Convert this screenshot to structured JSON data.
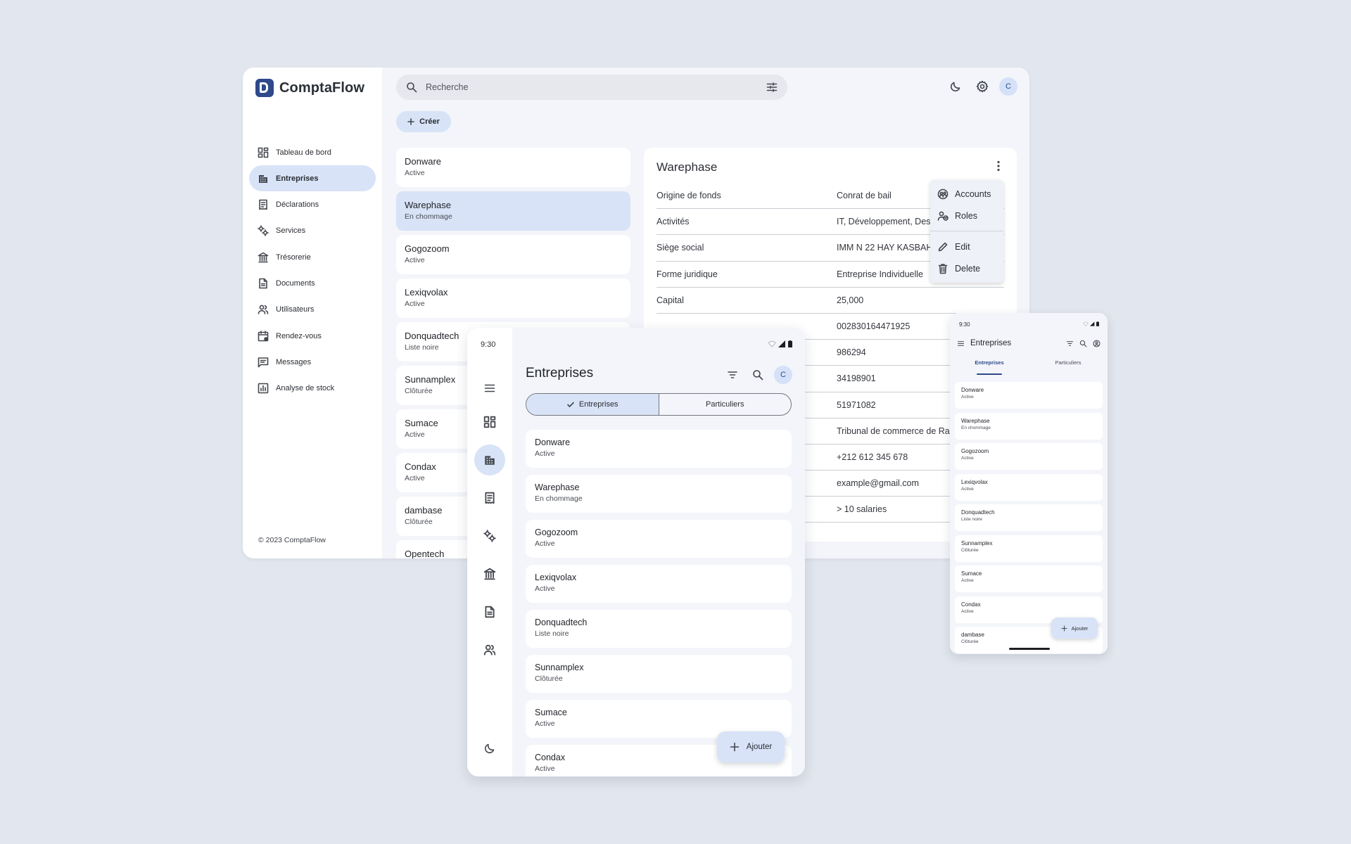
{
  "desktop": {
    "app_name": "ComptaFlow",
    "search_placeholder": "Recherche",
    "avatar_letter": "C",
    "create_label": "Créer",
    "nav": [
      {
        "label": "Tableau de bord",
        "icon": "dashboard-icon"
      },
      {
        "label": "Entreprises",
        "icon": "building-icon"
      },
      {
        "label": "Déclarations",
        "icon": "receipt-icon"
      },
      {
        "label": "Services",
        "icon": "services-icon"
      },
      {
        "label": "Trésorerie",
        "icon": "bank-icon"
      },
      {
        "label": "Documents",
        "icon": "document-icon"
      },
      {
        "label": "Utilisateurs",
        "icon": "users-icon"
      },
      {
        "label": "Rendez-vous",
        "icon": "calendar-icon"
      },
      {
        "label": "Messages",
        "icon": "message-icon"
      },
      {
        "label": "Analyse de stock",
        "icon": "chart-icon"
      }
    ],
    "copyright": "© 2023 ComptaFlow",
    "companies": [
      {
        "name": "Donware",
        "status": "Active"
      },
      {
        "name": "Warephase",
        "status": "En chommage"
      },
      {
        "name": "Gogozoom",
        "status": "Active"
      },
      {
        "name": "Lexiqvolax",
        "status": "Active"
      },
      {
        "name": "Donquadtech",
        "status": "Liste noire"
      },
      {
        "name": "Sunnamplex",
        "status": "Clôturée"
      },
      {
        "name": "Sumace",
        "status": "Active"
      },
      {
        "name": "Condax",
        "status": "Active"
      },
      {
        "name": "dambase",
        "status": "Clôturée"
      },
      {
        "name": "Opentech",
        "status": ""
      }
    ],
    "detail": {
      "title": "Warephase",
      "rows": [
        {
          "key": "Origine de fonds",
          "value": "Conrat de bail"
        },
        {
          "key": "Activités",
          "value": "IT, Développement, Des"
        },
        {
          "key": "Siège social",
          "value": "IMM N 22 HAY KASBAH"
        },
        {
          "key": "Forme juridique",
          "value": "Entreprise Individuelle"
        },
        {
          "key": "Capital",
          "value": "25,000"
        },
        {
          "key": "",
          "value": "002830164471925"
        },
        {
          "key": "",
          "value": "986294"
        },
        {
          "key": "",
          "value": "34198901"
        },
        {
          "key": "",
          "value": "51971082"
        },
        {
          "key": "",
          "value": "Tribunal de commerce de Ra"
        },
        {
          "key": "",
          "value": "+212 612 345 678"
        },
        {
          "key": "",
          "value": "example@gmail.com"
        },
        {
          "key": "",
          "value": "> 10 salaries"
        }
      ]
    },
    "context_menu": [
      "Accounts",
      "Roles",
      "Edit",
      "Delete"
    ]
  },
  "tablet": {
    "time": "9:30",
    "title": "Entreprises",
    "avatar_letter": "C",
    "segment_on": "Entreprises",
    "segment_off": "Particuliers",
    "fab_label": "Ajouter",
    "companies": [
      {
        "name": "Donware",
        "status": "Active"
      },
      {
        "name": "Warephase",
        "status": "En chommage"
      },
      {
        "name": "Gogozoom",
        "status": "Active"
      },
      {
        "name": "Lexiqvolax",
        "status": "Active"
      },
      {
        "name": "Donquadtech",
        "status": "Liste noire"
      },
      {
        "name": "Sunnamplex",
        "status": "Clôturée"
      },
      {
        "name": "Sumace",
        "status": "Active"
      },
      {
        "name": "Condax",
        "status": "Active"
      }
    ]
  },
  "phone": {
    "time": "9:30",
    "title": "Entreprises",
    "tab_on": "Entreprises",
    "tab_off": "Particuliers",
    "fab_label": "Ajouter",
    "companies": [
      {
        "name": "Donware",
        "status": "Active"
      },
      {
        "name": "Warephase",
        "status": "En chommage"
      },
      {
        "name": "Gogozoom",
        "status": "Active"
      },
      {
        "name": "Lexiqvolax",
        "status": "Active"
      },
      {
        "name": "Donquadtech",
        "status": "Liste noire"
      },
      {
        "name": "Sunnamplex",
        "status": "Clôturée"
      },
      {
        "name": "Sumace",
        "status": "Active"
      },
      {
        "name": "Condax",
        "status": "Active"
      },
      {
        "name": "dambase",
        "status": "Clôturée"
      }
    ]
  },
  "colors": {
    "background": "#e2e6ee",
    "accent": "#d8e3f7",
    "brand": "#2f4a8a"
  }
}
